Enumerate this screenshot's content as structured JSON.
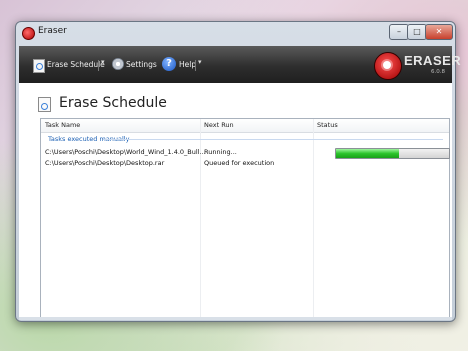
{
  "window": {
    "title": "Eraser"
  },
  "titlebar_buttons": {
    "minimize": "–",
    "maximize": "□",
    "close": "✕"
  },
  "toolbar": {
    "erase_schedule": "Erase Schedule",
    "settings": "Settings",
    "help": "Help",
    "dropdown_glyph": "▾"
  },
  "logo": {
    "text": "ERASER",
    "version": "6.0.8"
  },
  "page": {
    "title": "Erase Schedule"
  },
  "list": {
    "columns": [
      "Task Name",
      "Next Run",
      "Status"
    ],
    "group": "Tasks executed manually",
    "rows": [
      {
        "task": "C:\\Users\\Poschi\\Desktop\\World_Wind_1.4.0_Bull...",
        "next_run": "Running...",
        "progress": 0.56
      },
      {
        "task": "C:\\Users\\Poschi\\Desktop\\Desktop.rar",
        "next_run": "Queued for execution",
        "progress": null
      }
    ]
  },
  "colors": {
    "accent": "#1a5fb4",
    "progress": "#2bc42b",
    "brand": "#c00000"
  }
}
